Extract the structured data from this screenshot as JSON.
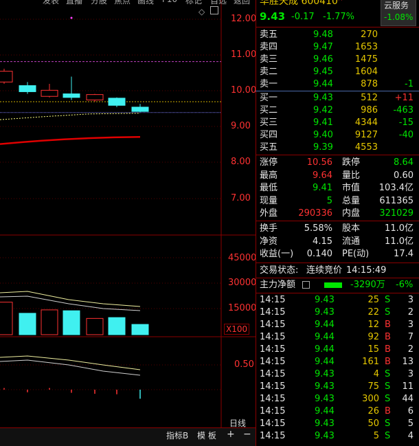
{
  "top_menu": [
    "发表",
    "直播",
    "分股",
    "焦点",
    "画线",
    "F10",
    "标记",
    "自选",
    "返回"
  ],
  "stock": {
    "name": "华胜天成",
    "code": "600410",
    "badge": "R",
    "price": "9.43",
    "change": "-0.17",
    "change_pct": "-1.77%"
  },
  "cloud": {
    "label": "云服务",
    "pct": "-1.08%"
  },
  "price_axis": [
    "12.00",
    "11.00",
    "10.00",
    "9.00",
    "8.00",
    "7.00"
  ],
  "volume_axis": [
    "45000",
    "30000",
    "15000"
  ],
  "volume_unit": "X100",
  "indicator_axis": [
    "0.50"
  ],
  "bottom_bar": {
    "period": "日线",
    "indicator": "指标B",
    "template": "模 板",
    "plus": "+",
    "minus": "−"
  },
  "sell_orders": [
    {
      "label": "卖五",
      "price": "9.48",
      "vol": "270",
      "delta": ""
    },
    {
      "label": "卖四",
      "price": "9.47",
      "vol": "1653",
      "delta": ""
    },
    {
      "label": "卖三",
      "price": "9.46",
      "vol": "1475",
      "delta": ""
    },
    {
      "label": "卖二",
      "price": "9.45",
      "vol": "1604",
      "delta": ""
    },
    {
      "label": "卖一",
      "price": "9.44",
      "vol": "878",
      "delta": "-1"
    }
  ],
  "buy_orders": [
    {
      "label": "买一",
      "price": "9.43",
      "vol": "512",
      "delta": "+11"
    },
    {
      "label": "买二",
      "price": "9.42",
      "vol": "986",
      "delta": "-463"
    },
    {
      "label": "买三",
      "price": "9.41",
      "vol": "4344",
      "delta": "-15"
    },
    {
      "label": "买四",
      "price": "9.40",
      "vol": "9127",
      "delta": "-40"
    },
    {
      "label": "买五",
      "price": "9.39",
      "vol": "4553",
      "delta": ""
    }
  ],
  "stats": [
    {
      "l1": "涨停",
      "v1": "10.56",
      "l2": "跌停",
      "v2": "8.64"
    },
    {
      "l1": "最高",
      "v1": "9.64",
      "l2": "量比",
      "v2": "0.60"
    },
    {
      "l1": "最低",
      "v1": "9.41",
      "l2": "市值",
      "v2": "103.4亿"
    },
    {
      "l1": "现量",
      "v1": "5",
      "l2": "总量",
      "v2": "611365"
    },
    {
      "l1": "外盘",
      "v1": "290336",
      "l2": "内盘",
      "v2": "321029"
    }
  ],
  "stats2": [
    {
      "l1": "换手",
      "v1": "5.58%",
      "l2": "股本",
      "v2": "11.0亿"
    },
    {
      "l1": "净资",
      "v1": "4.15",
      "l2": "流通",
      "v2": "11.0亿"
    },
    {
      "l1": "收益(一)",
      "v1": "0.140",
      "l2": "PE(动)",
      "v2": "17.4"
    }
  ],
  "trade_status": {
    "label": "交易状态:",
    "value": "连续竞价",
    "time": "14:15:49"
  },
  "main_flow": {
    "label": "主力净额",
    "amount": "-3290万",
    "pct": "-6%"
  },
  "ticks": [
    {
      "time": "14:15",
      "price": "9.43",
      "vol": "25",
      "side": "S",
      "n": "3"
    },
    {
      "time": "14:15",
      "price": "9.43",
      "vol": "22",
      "side": "S",
      "n": "2"
    },
    {
      "time": "14:15",
      "price": "9.44",
      "vol": "12",
      "side": "B",
      "n": "3"
    },
    {
      "time": "14:15",
      "price": "9.44",
      "vol": "92",
      "side": "B",
      "n": "7"
    },
    {
      "time": "14:15",
      "price": "9.44",
      "vol": "15",
      "side": "B",
      "n": "2"
    },
    {
      "time": "14:15",
      "price": "9.44",
      "vol": "161",
      "side": "B",
      "n": "13"
    },
    {
      "time": "14:15",
      "price": "9.43",
      "vol": "4",
      "side": "S",
      "n": "3"
    },
    {
      "time": "14:15",
      "price": "9.43",
      "vol": "75",
      "side": "S",
      "n": "11"
    },
    {
      "time": "14:15",
      "price": "9.43",
      "vol": "300",
      "side": "S",
      "n": "44"
    },
    {
      "time": "14:15",
      "price": "9.44",
      "vol": "26",
      "side": "B",
      "n": "6"
    },
    {
      "time": "14:15",
      "price": "9.43",
      "vol": "50",
      "side": "S",
      "n": "5"
    },
    {
      "time": "14:15",
      "price": "9.43",
      "vol": "5",
      "side": "S",
      "n": "4"
    }
  ],
  "chart_data": {
    "type": "candlestick",
    "price_ylim": [
      6.5,
      12.3
    ],
    "candles": [
      {
        "open": 10.25,
        "close": 10.55,
        "high": 10.62,
        "low": 10.2
      },
      {
        "open": 10.15,
        "close": 9.98,
        "high": 10.25,
        "low": 9.92
      },
      {
        "open": 9.85,
        "close": 10.02,
        "high": 10.2,
        "low": 9.82
      },
      {
        "open": 9.92,
        "close": 9.82,
        "high": 10.4,
        "low": 9.75
      },
      {
        "open": 9.75,
        "close": 9.9,
        "high": 9.92,
        "low": 9.7
      },
      {
        "open": 9.8,
        "close": 9.6,
        "high": 9.82,
        "low": 9.55
      },
      {
        "open": 9.55,
        "close": 9.43,
        "high": 9.64,
        "low": 9.41
      }
    ],
    "volume_ylim": [
      0,
      50000
    ],
    "volumes": [
      19000,
      12500,
      14500,
      14000,
      9500,
      10000,
      6000
    ],
    "indicator_ylim": [
      -0.2,
      0.8
    ],
    "indicator_bars": [
      0.0,
      -0.02,
      0.0,
      -0.03,
      -0.05,
      -0.06,
      -0.15
    ]
  }
}
